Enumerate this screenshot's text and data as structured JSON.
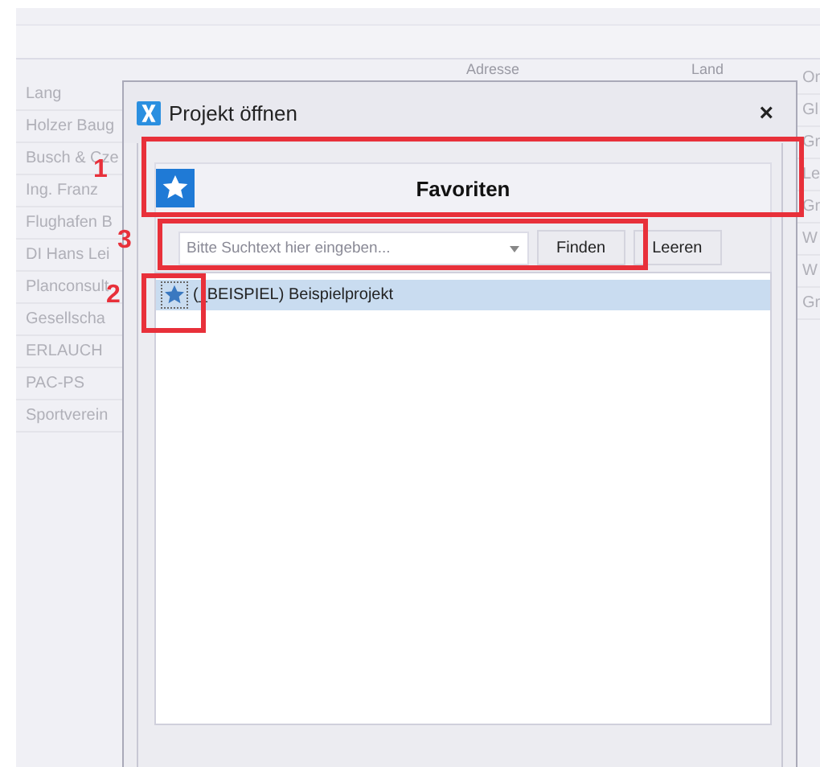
{
  "app": {
    "columns": [
      "Adresse",
      "Land"
    ],
    "names": [
      "Lang",
      "Holzer Baug",
      "Busch & Cze",
      "Ing. Franz",
      "Flughafen B",
      "DI Hans Lei",
      "Planconsult",
      "Gesellscha",
      "ERLAUCH",
      "PAC-PS",
      "Sportverein"
    ],
    "right_column": [
      "Or",
      "Gl",
      "Gr",
      "Le",
      "Gr",
      "W",
      "W",
      "Gr"
    ]
  },
  "dialog": {
    "title": "Projekt öffnen",
    "close": "×",
    "panel_title": "Favoriten",
    "search": {
      "placeholder": "Bitte Suchtext hier eingeben..."
    },
    "buttons": [
      "Finden",
      "Leeren"
    ],
    "projects": [
      {
        "label": "(_BEISPIEL) Beispielprojekt",
        "selected": true
      }
    ]
  },
  "annotations": [
    {
      "label": "1"
    },
    {
      "label": "3"
    },
    {
      "label": "2"
    }
  ]
}
